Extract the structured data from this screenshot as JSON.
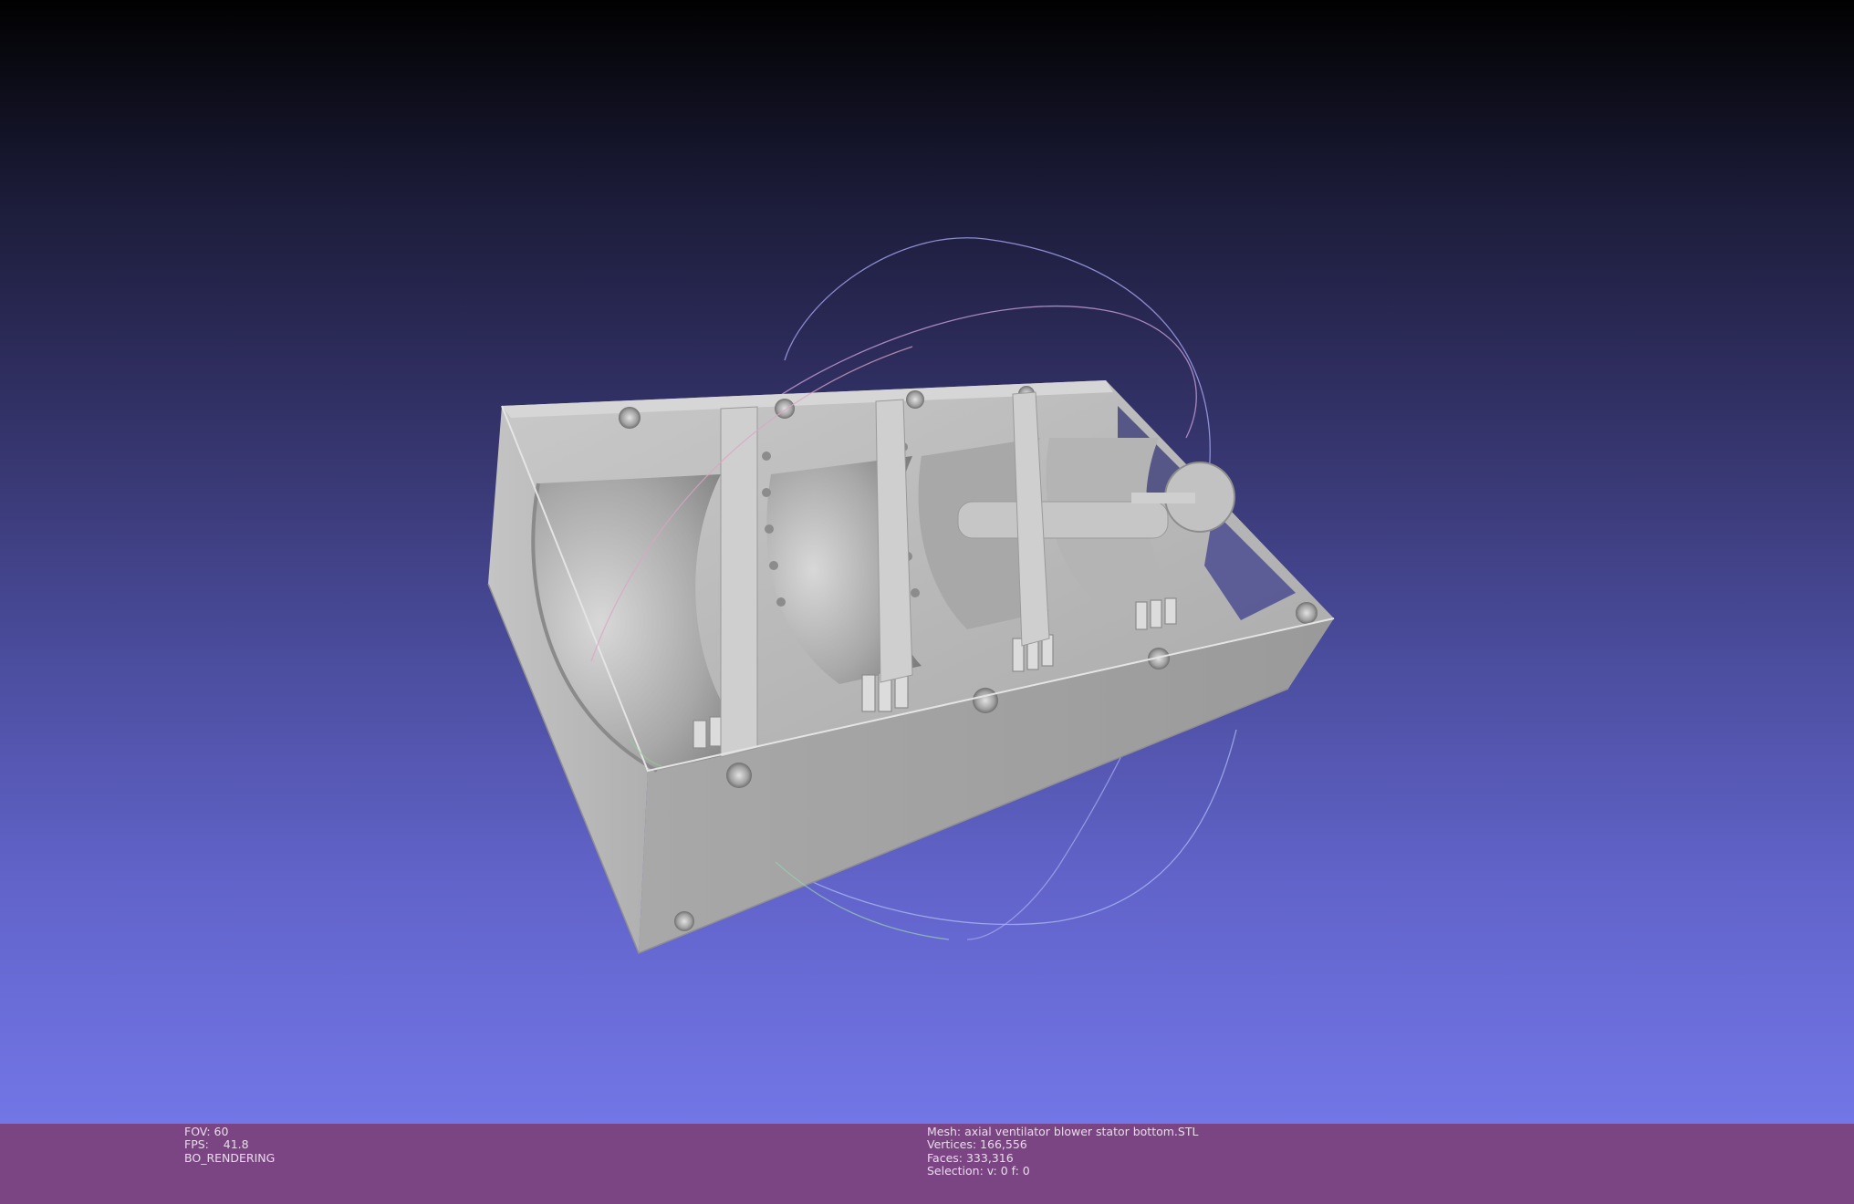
{
  "viewer": {
    "left_info": {
      "fov": "FOV: 60",
      "fps": "FPS:    41.8",
      "render_mode": "BO_RENDERING"
    },
    "right_info": {
      "mesh": "Mesh: axial ventilator blower stator bottom.STL",
      "vertices": "Vertices: 166,556",
      "faces": "Faces: 333,316",
      "selection": "Selection: v: 0 f: 0"
    }
  },
  "colors": {
    "viewport_top": "#010101",
    "viewport_bottom": "#7276e6",
    "infobar_bg": "#7b4584",
    "mesh_gray": "#b8b8b8"
  },
  "icons": {
    "trackball": "trackball-gizmo-icon",
    "mesh": "stl-mesh-model"
  }
}
